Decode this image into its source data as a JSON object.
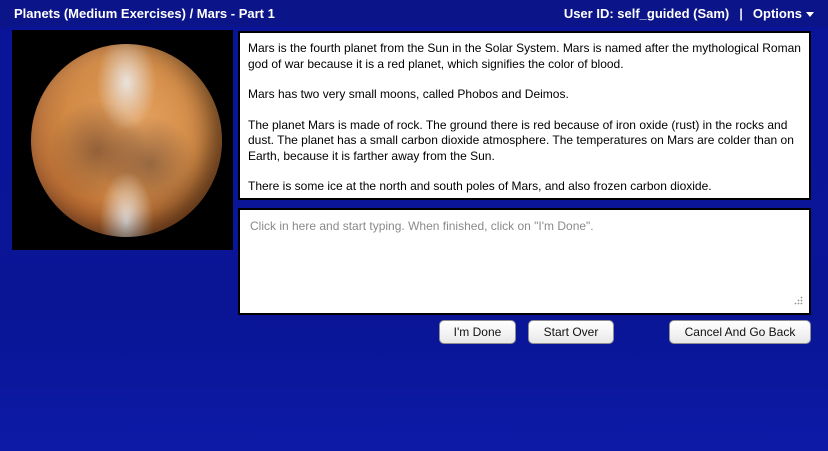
{
  "header": {
    "title": "Planets (Medium Exercises) / Mars - Part 1",
    "user_label": "User ID: self_guided (Sam)",
    "separator": "|",
    "options_label": "Options"
  },
  "content": {
    "paragraphs": [
      "Mars is the fourth planet from the Sun in the Solar System. Mars is named after the mythological Roman god of war because it is a red planet, which signifies the color of blood.",
      "Mars has two very small moons, called Phobos and Deimos.",
      "The planet Mars is made of rock. The ground there is red because of iron oxide (rust) in the rocks and dust. The planet has a small carbon dioxide atmosphere. The temperatures on Mars are colder than on Earth, because it is farther away from the Sun.",
      "There is some ice at the north and south poles of Mars, and also frozen carbon dioxide."
    ]
  },
  "answer": {
    "value": "",
    "placeholder": "Click in here and start typing. When finished, click on \"I'm Done\"."
  },
  "buttons": {
    "done": "I'm Done",
    "start_over": "Start Over",
    "cancel": "Cancel And Go Back"
  },
  "colors": {
    "background": "#0a1499",
    "topbar": "#0b1488",
    "panel_border": "#000000"
  }
}
